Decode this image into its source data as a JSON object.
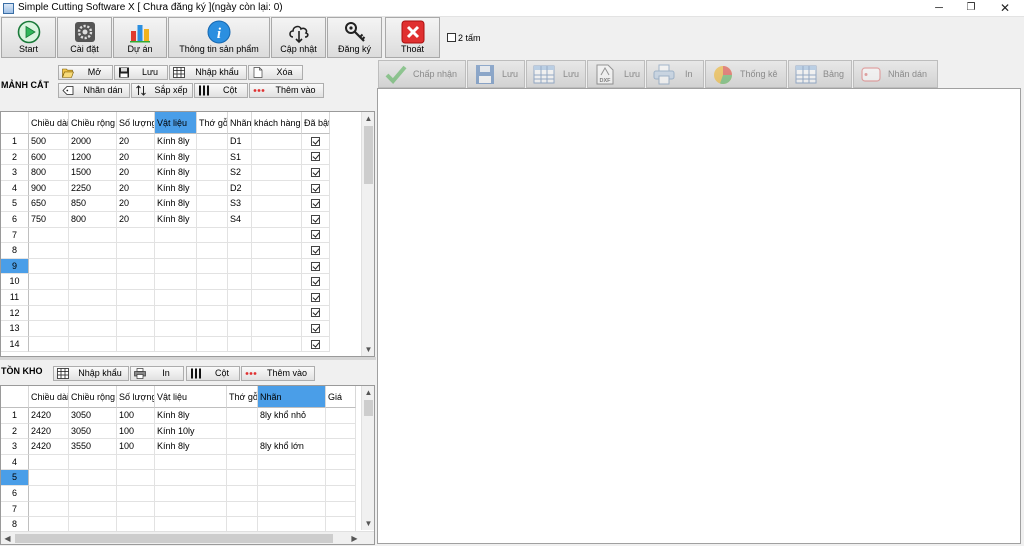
{
  "window": {
    "title": "Simple Cutting Software X [ Chưa đăng ký ](ngày còn lại: 0)",
    "minimize": "─",
    "maximize": "❐",
    "close": "✕"
  },
  "toolbar": {
    "start": "Start",
    "settings": "Cài đặt",
    "project": "Dự án",
    "product_info": "Thông tin sản phẩm",
    "update": "Cập nhật",
    "register": "Đăng ký",
    "exit": "Thoát",
    "two_sheets": "2 tấm"
  },
  "pieces": {
    "label": "MẢNH CẮT",
    "buttons": {
      "open": "Mở",
      "save": "Lưu",
      "import": "Nhập khẩu",
      "delete": "Xóa",
      "label": "Nhãn dán",
      "sort": "Sắp xếp",
      "column": "Cột",
      "add": "Thêm vào"
    },
    "columns": [
      "Chiều dài",
      "Chiều rộng",
      "Số lượng",
      "Vật liệu",
      "Thớ gỗ",
      "Nhãn",
      "khách hàng",
      "Đã bật"
    ],
    "row_numbers": [
      "1",
      "2",
      "3",
      "4",
      "5",
      "6",
      "7",
      "8",
      "9",
      "10",
      "11",
      "12",
      "13",
      "14"
    ],
    "rows": [
      [
        "500",
        "2000",
        "20",
        "Kính 8ly",
        "",
        "D1",
        ""
      ],
      [
        "600",
        "1200",
        "20",
        "Kính 8ly",
        "",
        "S1",
        ""
      ],
      [
        "800",
        "1500",
        "20",
        "Kính 8ly",
        "",
        "S2",
        ""
      ],
      [
        "900",
        "2250",
        "20",
        "Kính 8ly",
        "",
        "D2",
        ""
      ],
      [
        "650",
        "850",
        "20",
        "Kính 8ly",
        "",
        "S3",
        ""
      ],
      [
        "750",
        "800",
        "20",
        "Kính 8ly",
        "",
        "S4",
        ""
      ]
    ],
    "selected_row": "9",
    "selected_column": "Vật liệu"
  },
  "stock": {
    "label": "TỒN KHO",
    "buttons": {
      "import": "Nhập khẩu",
      "print": "In",
      "column": "Cột",
      "add": "Thêm vào"
    },
    "columns": [
      "Chiều dài",
      "Chiều rộng",
      "Số lượng",
      "Vật liệu",
      "Thớ gỗ",
      "Nhãn",
      "Giá"
    ],
    "row_numbers": [
      "1",
      "2",
      "3",
      "4",
      "5",
      "6",
      "7",
      "8"
    ],
    "rows": [
      [
        "2420",
        "3050",
        "100",
        "Kính 8ly",
        "",
        "8ly khổ nhỏ",
        ""
      ],
      [
        "2420",
        "3050",
        "100",
        "Kính 10ly",
        "",
        "",
        ""
      ],
      [
        "2420",
        "3550",
        "100",
        "Kính 8ly",
        "",
        "8ly khổ lớn",
        ""
      ]
    ],
    "selected_row": "5",
    "selected_column": "Nhãn"
  },
  "result_toolbar": {
    "accept": "Chấp nhận",
    "save": "Lưu",
    "save_table": "Lưu",
    "save_dxf": "Lưu",
    "print": "In",
    "stats": "Thống kê",
    "table": "Bảng",
    "label": "Nhãn dán"
  },
  "colors": {
    "selection": "#4a9ee8",
    "start_green": "#2fb65a",
    "exit_red": "#e03030",
    "info_blue": "#2b8fe0"
  }
}
